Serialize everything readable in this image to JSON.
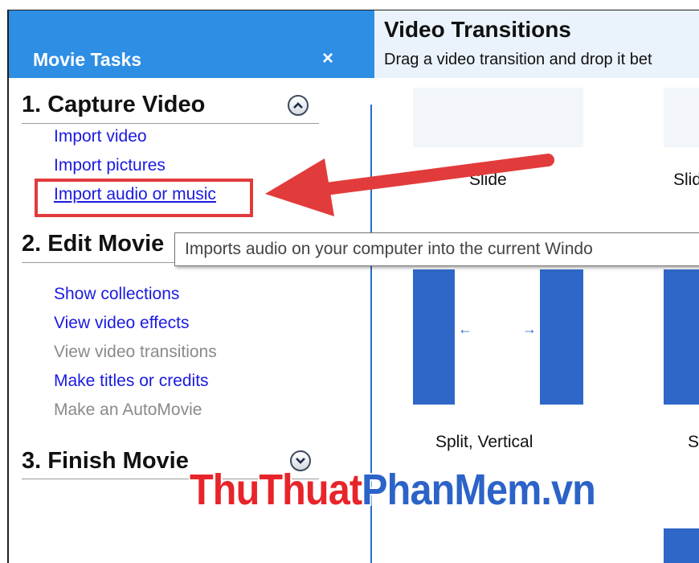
{
  "task_pane": {
    "title": "Movie Tasks",
    "close_glyph": "×",
    "sections": [
      {
        "heading": "1. Capture Video",
        "toggle": "collapse-chevron-up-icon",
        "links": [
          {
            "label": "Import video",
            "enabled": true
          },
          {
            "label": "Import pictures",
            "enabled": true
          },
          {
            "label": "Import audio or music",
            "enabled": true,
            "hovered": true
          }
        ]
      },
      {
        "heading": "2. Edit Movie",
        "links": [
          {
            "label": "Show collections",
            "enabled": true
          },
          {
            "label": "View video effects",
            "enabled": true
          },
          {
            "label": "View video transitions",
            "enabled": false
          },
          {
            "label": "Make titles or credits",
            "enabled": true
          },
          {
            "label": "Make an AutoMovie",
            "enabled": false
          }
        ]
      },
      {
        "heading": "3. Finish Movie",
        "toggle": "expand-chevron-down-icon",
        "links": []
      }
    ]
  },
  "tooltip": {
    "text": "Imports audio on your computer into the current Windo"
  },
  "transitions_pane": {
    "title": "Video Transitions",
    "subtitle": "Drag a video transition and drop it bet",
    "items": [
      {
        "label": "Slide"
      },
      {
        "label": "Slid"
      },
      {
        "label": "Split, Vertical"
      },
      {
        "label": "S"
      }
    ]
  },
  "annotation": {
    "color": "#e23b3b"
  },
  "watermark": {
    "part1": "ThuThuat",
    "part2": "PhanMem.vn"
  },
  "colors": {
    "header_blue": "#2e8ee4",
    "link_blue": "#1a1ae0",
    "accent_blue": "#2f67c9"
  }
}
